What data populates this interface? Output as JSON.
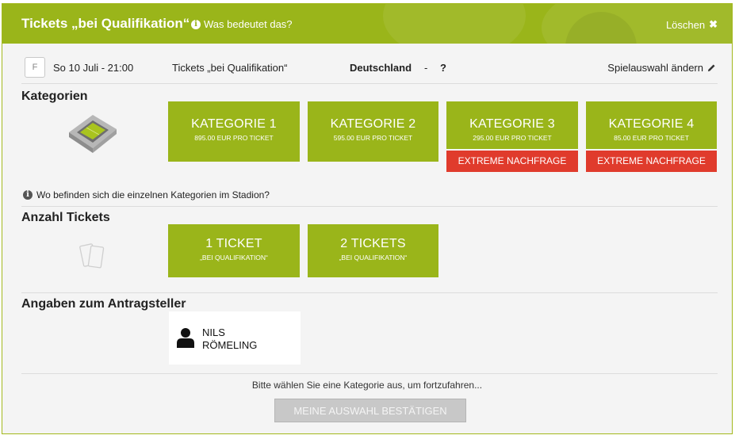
{
  "header": {
    "title": "Tickets „bei Qualifikation“",
    "info_link": "Was bedeutet das?",
    "clear_label": "Löschen"
  },
  "match": {
    "badge": "F",
    "date": "So 10 Juli - 21:00",
    "ticket_type": "Tickets „bei Qualifikation“",
    "team": "Deutschland",
    "separator": "-",
    "opponent": "?",
    "change_label": "Spielauswahl ändern"
  },
  "categories": {
    "title": "Kategorien",
    "items": [
      {
        "name": "KATEGORIE 1",
        "price": "895.00 EUR PRO TICKET",
        "demand": ""
      },
      {
        "name": "KATEGORIE 2",
        "price": "595.00 EUR PRO TICKET",
        "demand": ""
      },
      {
        "name": "KATEGORIE 3",
        "price": "295.00 EUR PRO TICKET",
        "demand": "EXTREME NACHFRAGE"
      },
      {
        "name": "KATEGORIE 4",
        "price": "85.00 EUR PRO TICKET",
        "demand": "EXTREME NACHFRAGE"
      }
    ],
    "info_text": "Wo befinden sich die einzelnen Kategorien im Stadion?"
  },
  "tickets": {
    "title": "Anzahl Tickets",
    "options": [
      {
        "label": "1 TICKET",
        "sub": "„BEI QUALIFIKATION“"
      },
      {
        "label": "2 TICKETS",
        "sub": "„BEI QUALIFIKATION“"
      }
    ]
  },
  "applicant": {
    "title": "Angaben zum Antragsteller",
    "first_name": "NILS",
    "last_name": "RÖMELING"
  },
  "footer": {
    "hint": "Bitte wählen Sie eine Kategorie aus, um fortzufahren...",
    "confirm_label": "MEINE AUSWAHL BESTÄTIGEN"
  },
  "colors": {
    "accent": "#9ab51a",
    "demand": "#e03b2c",
    "disabled_button": "#c8c8c8"
  }
}
